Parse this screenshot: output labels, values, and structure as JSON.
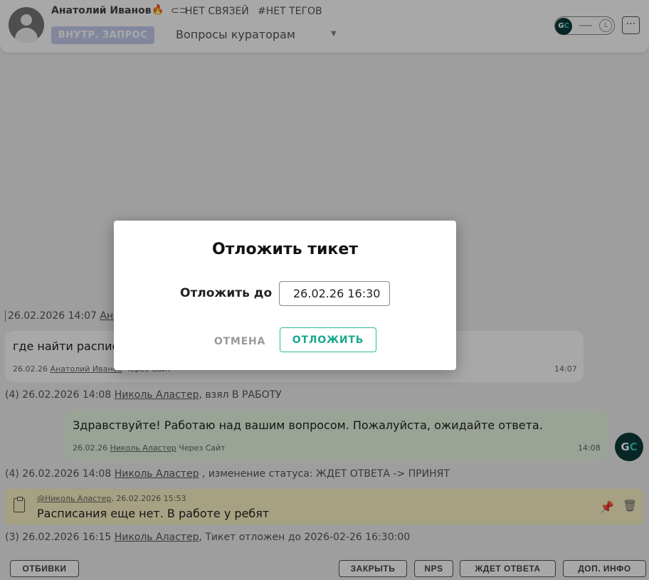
{
  "header": {
    "user_name": "Анатолий Иванов",
    "no_links": "НЕТ СВЯЗЕЙ",
    "no_tags": "#НЕТ ТЕГОВ",
    "badge": "ВНУТР. ЗАПРОС",
    "category": "Вопросы кураторам",
    "operator_initials_g": "G",
    "operator_initials_c": "C",
    "more": "···"
  },
  "icons": {
    "fire": "🔥",
    "link": "⊂⊃",
    "caret": "▼",
    "pin": "📌",
    "trash": "🗑"
  },
  "feed": {
    "line1_date": "26.02.2026 14:07",
    "line1_user": "Ана",
    "msg1_text": "где найти распис",
    "msg1_date": "26.02.26",
    "msg1_user": "Анатолий Иванов",
    "msg1_via": "Через Сайт",
    "msg1_time": "14:07",
    "line2_prefix": "(4) 26.02.2026 14:08",
    "line2_user": "Николь Аластер",
    "line2_suffix": ", взял В РАБОТУ",
    "msg2_text": "Здравствуйте! Работаю над вашим вопросом. Пожалуйста, ожидайте ответа.",
    "msg2_date": "26.02.26",
    "msg2_user": "Николь Аластер",
    "msg2_via": "Через Сайт",
    "msg2_time": "14:08",
    "line3_prefix": "(4) 26.02.2026 14:08",
    "line3_user": "Николь Аластер",
    "line3_suffix": " , изменение статуса: ЖДЕТ ОТВЕТА -> ПРИНЯТ",
    "note_user": "@Николь Аластер",
    "note_date": ", 26.02.2026 15:53",
    "note_text": "Расписания еще нет. В работе у ребят",
    "line4_prefix": "(3) 26.02.2026 16:15",
    "line4_user": "Николь Аластер",
    "line4_suffix": ", Тикет отложен до 2026-02-26 16:30:00"
  },
  "actions": {
    "otbivki": "ОТБИВКИ",
    "close": "ЗАКРЫТЬ",
    "nps": "NPS",
    "await": "ЖДЕТ ОТВЕТА",
    "more_info": "ДОП. ИНФО"
  },
  "modal": {
    "title": "Отложить тикет",
    "label": "Отложить до",
    "value": "26.02.26 16:30",
    "cancel": "ОТМЕНА",
    "confirm": "ОТЛОЖИТЬ"
  }
}
